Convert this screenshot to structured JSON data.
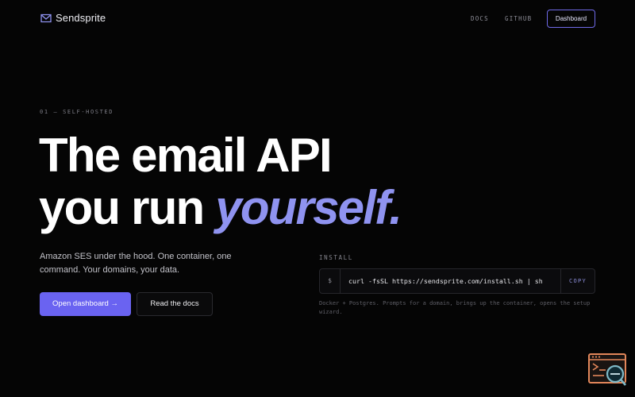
{
  "header": {
    "brand": "Sendsprite",
    "nav": {
      "docs": "DOCS",
      "github": "GITHUB"
    },
    "dashboard_button": "Dashboard"
  },
  "hero": {
    "eyebrow": "01 — SELF-HOSTED",
    "headline_line1": "The email API",
    "headline_line2_plain": "you run ",
    "headline_line2_accent": "yourself.",
    "lede": "Amazon SES under the hood. One container, one command. Your domains, your data.",
    "primary_button": "Open dashboard →",
    "secondary_button": "Read the docs"
  },
  "install": {
    "label": "INSTALL",
    "prompt": "$",
    "command": "curl -fsSL https://sendsprite.com/install.sh | sh",
    "copy_label": "COPY",
    "note": "Docker + Postgres. Prompts for a domain, brings up the container, opens the setup wizard."
  },
  "colors": {
    "background": "#050505",
    "accent": "#6a63f1",
    "accent_text": "#8f93f0"
  },
  "icons": {
    "brand": "envelope-icon",
    "widget": "code-window-search-icon"
  }
}
